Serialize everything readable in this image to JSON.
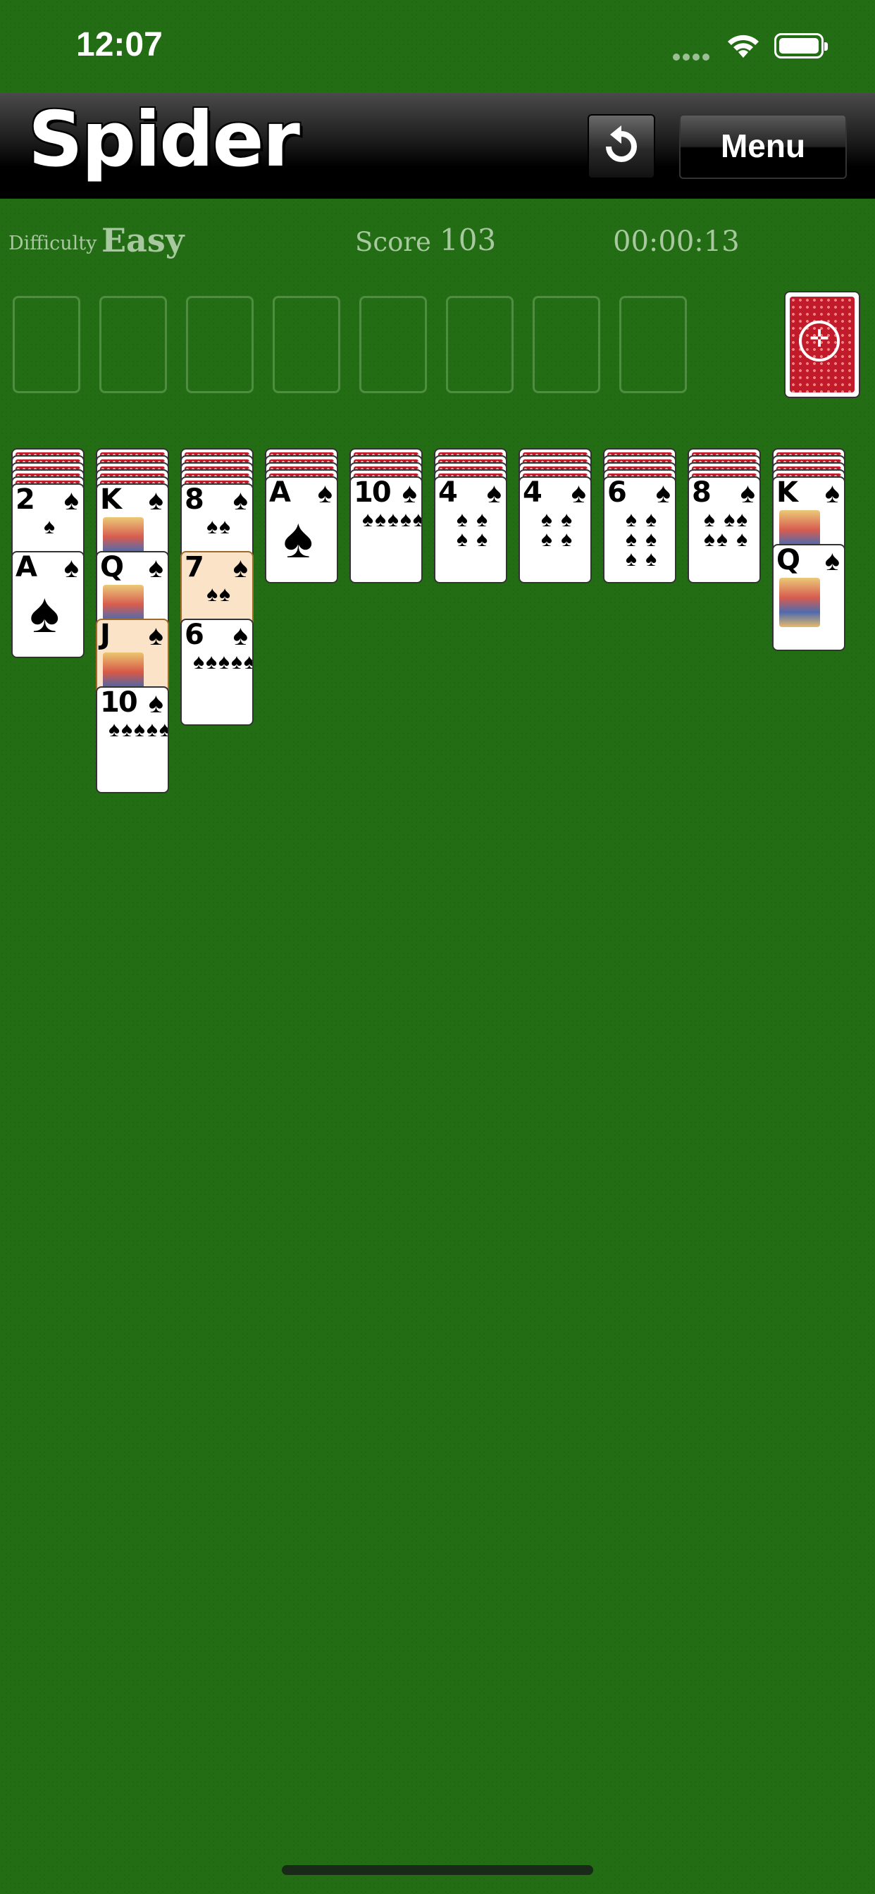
{
  "status": {
    "time": "12:07"
  },
  "header": {
    "title": "Spider",
    "menu_label": "Menu",
    "undo_icon": "undo-icon"
  },
  "info": {
    "difficulty_label": "Difficulty",
    "difficulty_value": "Easy",
    "score_label": "Score",
    "score_value": "103",
    "timer": "00:00:13"
  },
  "colors": {
    "felt": "#236d14",
    "card_back": "#c11a2a",
    "selected": "#fbe3c8"
  },
  "tableau": [
    {
      "hidden": 5,
      "up": [
        {
          "rank": "2",
          "suit": "♠",
          "pips": "♠"
        },
        {
          "rank": "A",
          "suit": "♠",
          "pips": ""
        }
      ]
    },
    {
      "hidden": 5,
      "up": [
        {
          "rank": "K",
          "suit": "♠",
          "face": true
        },
        {
          "rank": "Q",
          "suit": "♠",
          "face": true
        },
        {
          "rank": "J",
          "suit": "♠",
          "face": true,
          "sel": true
        },
        {
          "rank": "10",
          "suit": "♠",
          "pips": "♠♠♠♠♠♠♠♠"
        }
      ]
    },
    {
      "hidden": 5,
      "up": [
        {
          "rank": "8",
          "suit": "♠",
          "pips": "♠♠"
        },
        {
          "rank": "7",
          "suit": "♠",
          "pips": "♠♠",
          "sel": true
        },
        {
          "rank": "6",
          "suit": "♠",
          "pips": "♠♠♠♠♠"
        }
      ]
    },
    {
      "hidden": 4,
      "up": [
        {
          "rank": "A",
          "suit": "♠",
          "pips": ""
        }
      ]
    },
    {
      "hidden": 4,
      "up": [
        {
          "rank": "10",
          "suit": "♠",
          "pips": "♠♠♠♠♠♠"
        }
      ]
    },
    {
      "hidden": 4,
      "up": [
        {
          "rank": "4",
          "suit": "♠",
          "pips": "♠ ♠   ♠ ♠"
        }
      ]
    },
    {
      "hidden": 4,
      "up": [
        {
          "rank": "4",
          "suit": "♠",
          "pips": "♠ ♠   ♠ ♠"
        }
      ]
    },
    {
      "hidden": 4,
      "up": [
        {
          "rank": "6",
          "suit": "♠",
          "pips": "♠ ♠ ♠ ♠ ♠ ♠"
        }
      ]
    },
    {
      "hidden": 4,
      "up": [
        {
          "rank": "8",
          "suit": "♠",
          "pips": "♠ ♠♠ ♠♠ ♠"
        }
      ]
    },
    {
      "hidden": 4,
      "up": [
        {
          "rank": "K",
          "suit": "♠",
          "face": true
        },
        {
          "rank": "Q",
          "suit": "♠",
          "face": true
        }
      ]
    }
  ]
}
